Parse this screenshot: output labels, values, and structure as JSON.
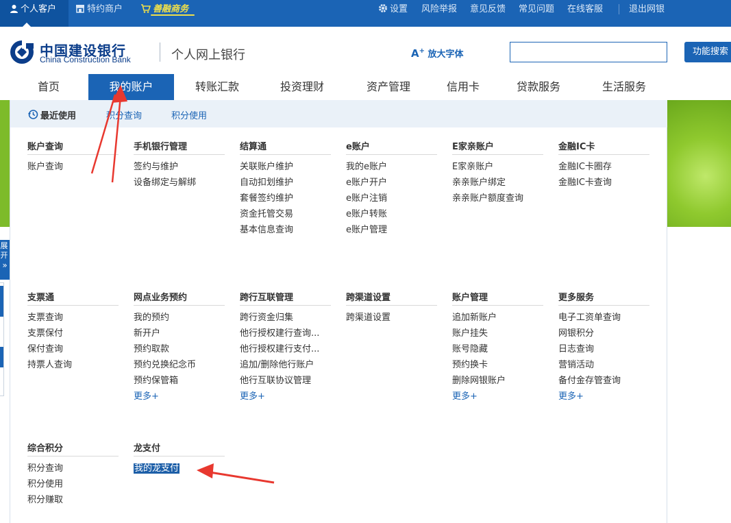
{
  "topbar": {
    "personal": "个人客户",
    "merchant": "特约商户",
    "shanrong": "善融商务",
    "settings": "设置",
    "risk_report": "风险举报",
    "feedback": "意见反馈",
    "faq": "常见问题",
    "online_service": "在线客服",
    "logout": "退出网银"
  },
  "header": {
    "bank_name_cn": "中国建设银行",
    "bank_name_en": "China Construction Bank",
    "title": "个人网上银行",
    "enlarge_font": "放大字体",
    "search_value": "",
    "search_button": "功能搜索"
  },
  "nav": {
    "items": [
      "首页",
      "我的账户",
      "转账汇款",
      "投资理财",
      "资产管理",
      "信用卡",
      "贷款服务",
      "生活服务"
    ]
  },
  "sidebar": {
    "expand_label": "展开",
    "expand_icon": "»"
  },
  "menu": {
    "recent_label": "最近使用",
    "recent_links": [
      "积分查询",
      "积分使用"
    ],
    "columns": [
      {
        "title": "账户查询",
        "links": [
          "账户查询"
        ]
      },
      {
        "title": "手机银行管理",
        "links": [
          "签约与维护",
          "设备绑定与解绑"
        ]
      },
      {
        "title": "结算通",
        "links": [
          "关联账户维护",
          "自动扣划维护",
          "套餐签约维护",
          "资金托管交易",
          "基本信息查询"
        ]
      },
      {
        "title": "e账户",
        "links": [
          "我的e账户",
          "e账户开户",
          "e账户注销",
          "e账户转账",
          "e账户管理"
        ]
      },
      {
        "title": "E家亲账户",
        "links": [
          "E家亲账户",
          "亲亲账户绑定",
          "亲亲账户额度查询"
        ]
      },
      {
        "title": "金融IC卡",
        "links": [
          "金融IC卡圈存",
          "金融IC卡查询"
        ]
      },
      {
        "title": "支票通",
        "links": [
          "支票查询",
          "支票保付",
          "保付查询",
          "持票人查询"
        ]
      },
      {
        "title": "网点业务预约",
        "links": [
          "我的预约",
          "新开户",
          "预约取款",
          "预约兑换纪念币",
          "预约保管箱"
        ],
        "more": "更多+"
      },
      {
        "title": "跨行互联管理",
        "links": [
          "跨行资金归集",
          "他行授权建行查询...",
          "他行授权建行支付...",
          "追加/删除他行账户",
          "他行互联协议管理"
        ],
        "more": "更多+"
      },
      {
        "title": "跨渠道设置",
        "links": [
          "跨渠道设置"
        ]
      },
      {
        "title": "账户管理",
        "links": [
          "追加新账户",
          "账户挂失",
          "账号隐藏",
          "预约换卡",
          "删除网银账户"
        ],
        "more": "更多+"
      },
      {
        "title": "更多服务",
        "links": [
          "电子工资单查询",
          "网银积分",
          "日志查询",
          "营销活动",
          "备付金存管查询"
        ],
        "more": "更多+"
      },
      {
        "title": "综合积分",
        "links": [
          "积分查询",
          "积分使用",
          "积分赚取"
        ]
      },
      {
        "title": "龙支付",
        "links": [
          "我的龙支付"
        ]
      }
    ]
  },
  "colors": {
    "brand_blue": "#1b64b5",
    "annotation_red": "#e8382f",
    "banner_green": "#7dbb2a"
  }
}
